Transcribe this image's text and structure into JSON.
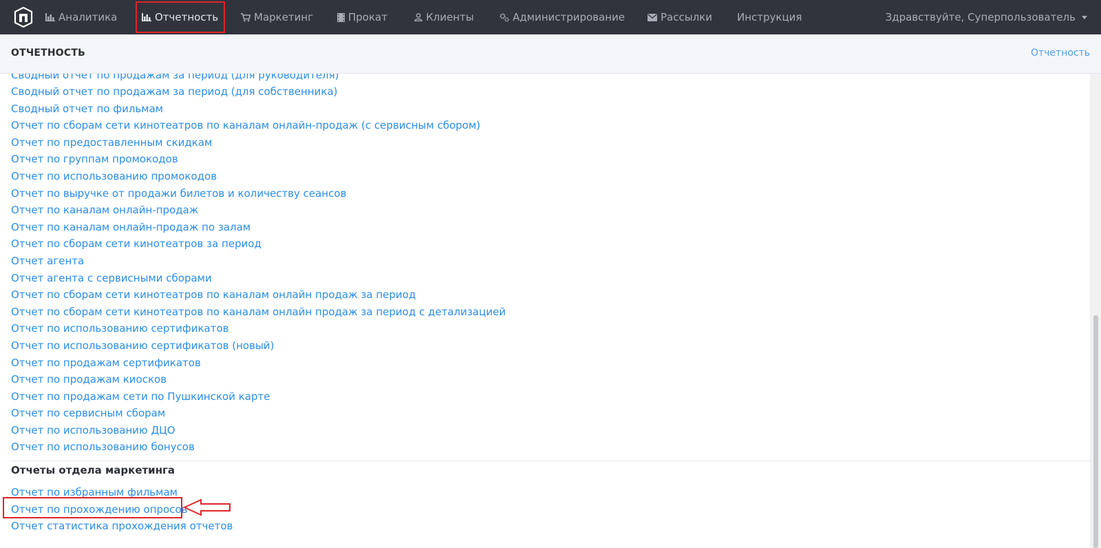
{
  "nav": {
    "items": [
      {
        "label": "Аналитика",
        "icon": "bar-chart-icon"
      },
      {
        "label": "Отчетность",
        "icon": "bar-chart-icon"
      },
      {
        "label": "Маркетинг",
        "icon": "cart-icon"
      },
      {
        "label": "Прокат",
        "icon": "film-icon"
      },
      {
        "label": "Клиенты",
        "icon": "user-icon"
      },
      {
        "label": "Администрирование",
        "icon": "gears-icon"
      },
      {
        "label": "Рассылки",
        "icon": "envelope-icon"
      },
      {
        "label": "Инструкция",
        "icon": ""
      }
    ],
    "user_greeting": "Здравствуйте, Суперпользователь"
  },
  "header": {
    "title": "ОТЧЕТНОСТЬ",
    "breadcrumb": "Отчетность"
  },
  "reports": [
    "Сводный отчет по продажам за период (для руководителя)",
    "Сводный отчет по продажам за период (для собственника)",
    "Сводный отчет по фильмам",
    "Отчет по сборам сети кинотеатров по каналам онлайн-продаж (с сервисным сбором)",
    "Отчет по предоставленным скидкам",
    "Отчет по группам промокодов",
    "Отчет по использованию промокодов",
    "Отчет по выручке от продажи билетов и количеству сеансов",
    "Отчет по каналам онлайн-продаж",
    "Отчет по каналам онлайн-продаж по залам",
    "Отчет по сборам сети кинотеатров за период",
    "Отчет агента",
    "Отчет агента с сервисными сборами",
    "Отчет по сборам сети кинотеатров по каналам онлайн продаж за период",
    "Отчет по сборам сети кинотеатров по каналам онлайн продаж за период с детализацией",
    "Отчет по использованию сертификатов",
    "Отчет по использованию сертификатов (новый)",
    "Отчет по продажам сертификатов",
    "Отчет по продажам киосков",
    "Отчет по продажам сети по Пушкинской карте",
    "Отчет по сервисным сборам",
    "Отчет по использованию ДЦО",
    "Отчет по использованию бонусов"
  ],
  "marketing": {
    "title": "Отчеты отдела маркетинга",
    "reports": [
      "Отчет по избранным фильмам",
      "Отчет по прохождению опросов",
      "Отчет статистика прохождения отчетов"
    ]
  },
  "colors": {
    "navbar_bg": "#32343d",
    "link": "#2a8ee6",
    "annotation": "#e0232b"
  }
}
